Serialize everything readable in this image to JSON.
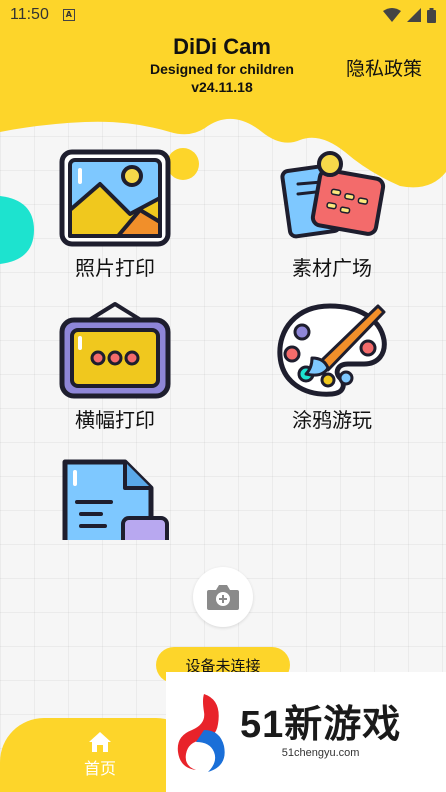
{
  "status_bar": {
    "time": "11:50",
    "badge": "A"
  },
  "header": {
    "title": "DiDi Cam",
    "subtitle": "Designed for children",
    "version": "v24.11.18",
    "privacy_label": "隐私政策"
  },
  "tiles": [
    {
      "label": "照片打印",
      "icon": "photo-print-icon"
    },
    {
      "label": "素材广场",
      "icon": "material-square-icon"
    },
    {
      "label": "横幅打印",
      "icon": "banner-print-icon"
    },
    {
      "label": "涂鸦游玩",
      "icon": "doodle-palette-icon"
    },
    {
      "label": "",
      "icon": "document-print-icon"
    }
  ],
  "device_status": "设备未连接",
  "nav": {
    "home_label": "首页"
  },
  "watermark": {
    "brand": "51新游戏",
    "url": "51chengyu.com"
  },
  "colors": {
    "accent": "#fdd52a",
    "teal": "#1de3cf",
    "outline": "#1e1e2e"
  }
}
